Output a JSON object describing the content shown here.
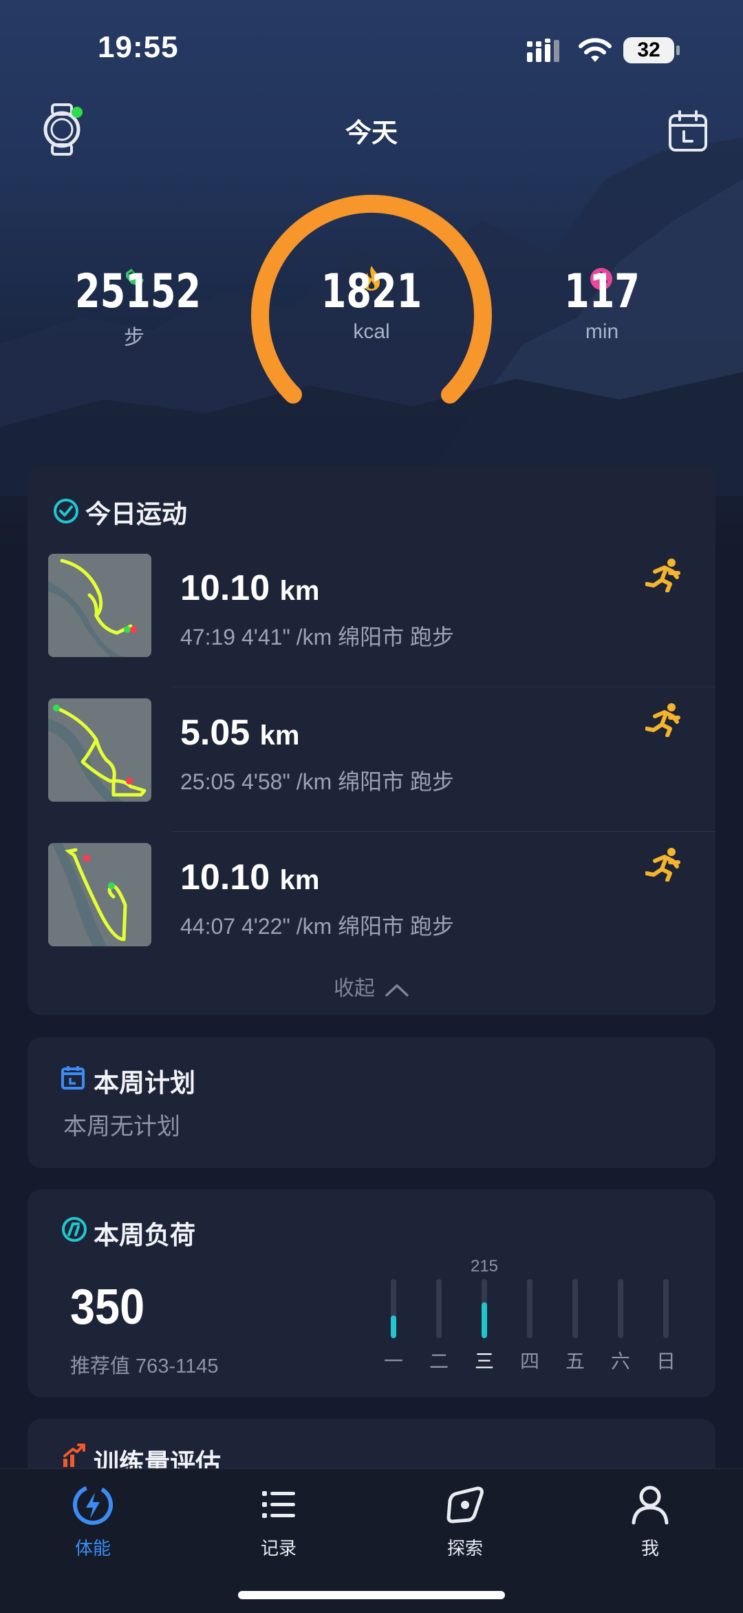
{
  "status_bar": {
    "time": "19:55",
    "battery": "32"
  },
  "header": {
    "title": "今天"
  },
  "stats": {
    "steps": {
      "value": "25152",
      "unit": "步"
    },
    "calories": {
      "value": "1821",
      "unit": "kcal"
    },
    "minutes": {
      "value": "117",
      "unit": "min"
    }
  },
  "today_activities": {
    "title": "今日运动",
    "items": [
      {
        "distance": "10.10",
        "unit": "km",
        "meta": "47:19  4'41\" /km 绵阳市 跑步"
      },
      {
        "distance": "5.05",
        "unit": "km",
        "meta": "25:05  4'58\" /km 绵阳市 跑步"
      },
      {
        "distance": "10.10",
        "unit": "km",
        "meta": "44:07  4'22\" /km 绵阳市 跑步"
      }
    ],
    "collapse_label": "收起"
  },
  "weekly_plan": {
    "title": "本周计划",
    "empty_text": "本周无计划"
  },
  "weekly_load": {
    "title": "本周负荷",
    "value": "350",
    "recommended": "推荐值 763-1145",
    "peak_label": "215",
    "days": [
      "一",
      "二",
      "三",
      "四",
      "五",
      "六",
      "日"
    ],
    "levels": [
      0.38,
      0,
      0.6,
      0,
      0,
      0,
      0
    ],
    "selected_day": "三"
  },
  "training_eval": {
    "title": "训练量评估"
  },
  "tabs": [
    {
      "label": "体能",
      "active": true
    },
    {
      "label": "记录",
      "active": false
    },
    {
      "label": "探索",
      "active": false
    },
    {
      "label": "我",
      "active": false
    }
  ],
  "colors": {
    "accent": "#3b8cf5",
    "gauge": "#f7962a",
    "bar": "#22c6cf",
    "run_icon": "#f4b42c"
  }
}
